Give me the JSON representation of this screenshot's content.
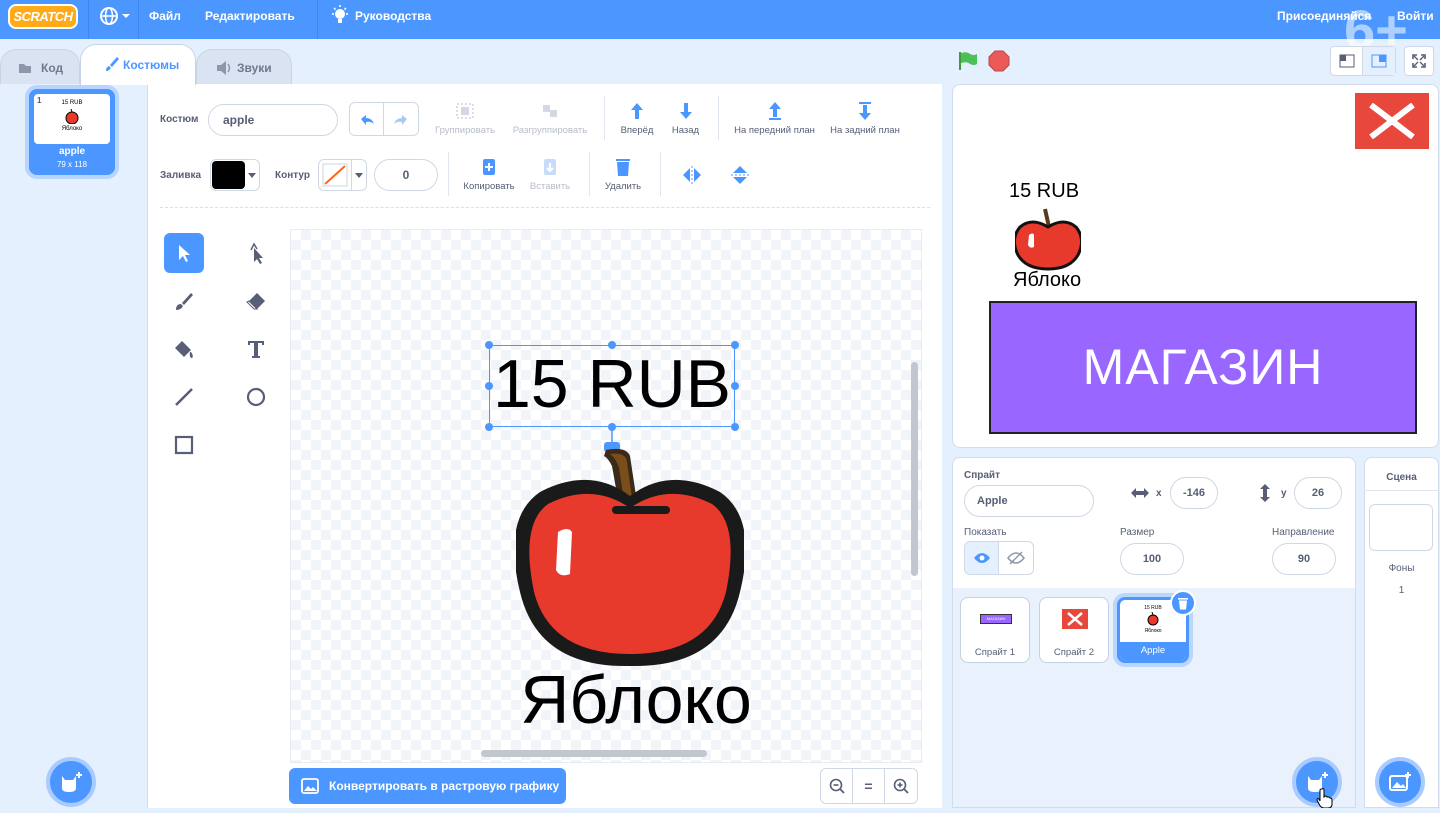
{
  "menubar": {
    "logo": "SCRATCH",
    "file": "Файл",
    "edit": "Редактировать",
    "tutorials": "Руководства",
    "join": "Присоединяйся",
    "signin": "Войти",
    "age_rating": "6+"
  },
  "tabs": {
    "code": "Код",
    "costumes": "Костюмы",
    "sounds": "Звуки"
  },
  "costume_list": [
    {
      "index": "1",
      "name": "apple",
      "size": "79 x 118",
      "thumb_price": "15 RUB",
      "thumb_word": "Яблоко"
    }
  ],
  "editor": {
    "costume_label": "Костюм",
    "costume_name": "apple",
    "group": "Группировать",
    "ungroup": "Разгруппировать",
    "forward": "Вперёд",
    "backward": "Назад",
    "front": "На передний план",
    "back": "На задний план",
    "fill_label": "Заливка",
    "fill_color": "#000000",
    "outline_label": "Контур",
    "outline_width": "0",
    "copy": "Копировать",
    "paste": "Вставить",
    "delete": "Удалить",
    "convert_button": "Конвертировать в растровую графику",
    "zoom_reset": "=",
    "canvas_price": "15 RUB",
    "canvas_word": "Яблоко"
  },
  "stage": {
    "price": "15 RUB",
    "word": "Яблоко",
    "shop": "МАГАЗИН"
  },
  "sprite_info": {
    "sprite_label": "Спрайт",
    "sprite_name": "Apple",
    "x_label": "x",
    "x_value": "-146",
    "y_label": "y",
    "y_value": "26",
    "show_label": "Показать",
    "size_label": "Размер",
    "size_value": "100",
    "direction_label": "Направление",
    "direction_value": "90"
  },
  "sprites": [
    {
      "name": "Спрайт 1",
      "thumb_text": "МАГАЗИН"
    },
    {
      "name": "Спрайт 2"
    },
    {
      "name": "Apple",
      "thumb_price": "15 RUB",
      "thumb_word": "Яблоко",
      "selected": true
    }
  ],
  "stage_pane": {
    "title": "Сцена",
    "backdrops_label": "Фоны",
    "backdrops_count": "1"
  },
  "colors": {
    "accent": "#4c97ff",
    "shop_purple": "#9966ff",
    "close_red": "#e8473c",
    "apple_red": "#e8392d"
  }
}
